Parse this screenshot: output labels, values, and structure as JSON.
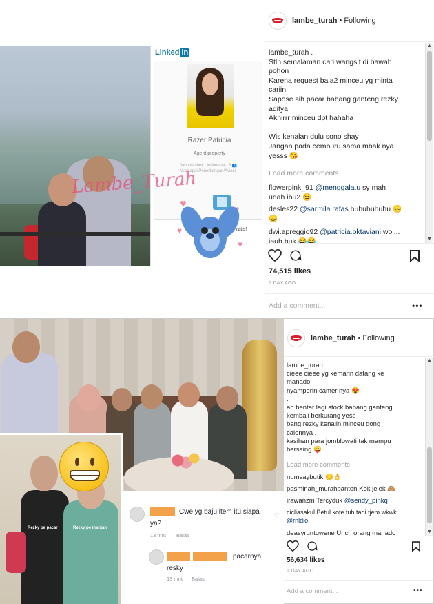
{
  "post1": {
    "username": "lambe_turah",
    "following": "• Following",
    "caption_lines": [
      "lambe_turah .",
      "Stlh semalaman cari wangsit di bawah",
      "pohon",
      "Karena request bala2 minceu yg minta",
      "cariin",
      "Sapose sih pacar babang ganteng rezky",
      "aditya",
      "Akhirrr minceu dpt hahaha",
      "",
      "Wis kenalan dulu sono shay",
      "Jangan pada cemburu sama mbak nya",
      "yesss 😘"
    ],
    "load_more": "Load more comments",
    "comments": [
      {
        "user": "flowerpink_91",
        "mention": "@menggala.u",
        "text": " sy mah",
        "cont": "udah ibu2 😉"
      },
      {
        "user": "desles22",
        "mention": "@sarmila.rafas",
        "text": " huhuhuhuhu 😞",
        "cont": "😞"
      },
      {
        "user": "dwi.apreggio92",
        "mention": "@patricia.oktaviani",
        "text": " woi...",
        "cont": "jauh buk 😂😂"
      }
    ],
    "likes": "74,515 likes",
    "date": "1 DAY AGO",
    "add_comment": "Add a comment...",
    "more": "•••",
    "watermark": "Lambe_Turah",
    "linkedin": {
      "logo": "Linked",
      "logo_in": "in",
      "name": "Razer Patricia",
      "title": "Agent property",
      "location_line1": "Jabodetabek , Indonesia  ·  3 👥",
      "location_line2": "Maskapai Penerbangan/Aviasi",
      "stitch_text": "ratis!"
    }
  },
  "post2": {
    "username": "lambe_turah",
    "following": "• Following",
    "caption_lines": [
      "lambe_turah .",
      "cieee cieee yg kemarin datang ke",
      "manado",
      "nyamperin camer nya 😍",
      ".",
      "ah bentar lagi stock babang ganteng",
      "kembali berkurang yess",
      "bang rezky kenalin minceu dong",
      "calonnya .",
      "kasihan para jomblowati tak mampu",
      "bersaing 😜"
    ],
    "load_more": "Load more comments",
    "comments": [
      {
        "user": "numsaybutik",
        "mention": "",
        "text": " 😊👌",
        "cont": ""
      },
      {
        "user": "pasminah_murahbanten",
        "mention": "",
        "text": " Kok jelek 🙈",
        "cont": ""
      },
      {
        "user": "irawanzm",
        "mention": "@sendy_pinkq",
        "text": "",
        "pre": " Tercyduk ",
        "cont": ""
      },
      {
        "user": "cicliasakul",
        "mention": "@rnldio",
        "text": "",
        "pre": " Betul kote tuh tadi tjem wkwk",
        "cont": ""
      },
      {
        "user": "deasyruntuwene",
        "mention": "",
        "text": " Unch orang manado",
        "cont": ""
      }
    ],
    "likes": "56,634 likes",
    "date": "1 DAY AGO",
    "add_comment": "Add a comment...",
    "more": "•••",
    "photo_tags": [
      "Rezky pe pacar",
      "Rezky pe mantan"
    ],
    "fb": {
      "c1_text": "Cwe yg baju item itu siapa",
      "c1_cont": "ya?",
      "c1_time": "13 mnt",
      "c1_reply": "Balas",
      "c2_text": "pacarnya",
      "c2_cont": "resky",
      "c2_time": "13 mnt",
      "c2_reply": "Balas"
    }
  },
  "colors": {
    "brand_red": "#d61f2b",
    "mention": "#003569",
    "blur_orange": "#f4a24a"
  }
}
